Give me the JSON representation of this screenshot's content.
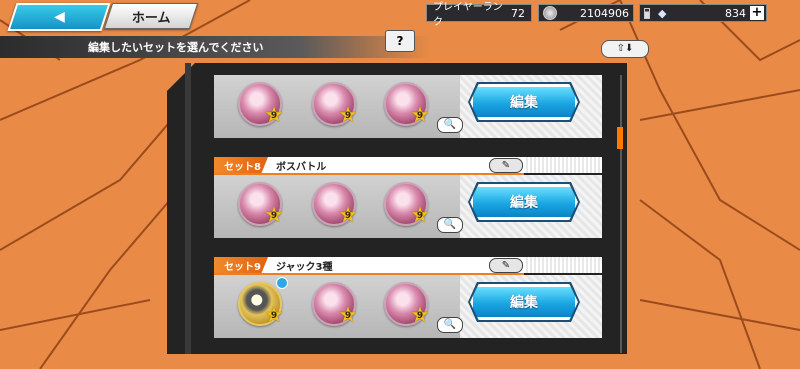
{
  "header": {
    "back_arrow": "◀",
    "home_label": "ホーム",
    "rank_label": "プレイヤーランク",
    "rank_value": "72",
    "coins": "2104906",
    "gems": "834",
    "plus": "+"
  },
  "instruction": "編集したいセットを選んでください",
  "help_label": "?",
  "sort_label": "⇧⬇",
  "sets": [
    {
      "tag": "",
      "name": "",
      "edit_label": "編集",
      "star_levels": [
        "9",
        "9",
        "9"
      ],
      "zoom_icon": "🔍"
    },
    {
      "tag": "セット8",
      "name": "ボスバトル",
      "edit_label": "編集",
      "pencil": "✎",
      "star_levels": [
        "9",
        "9",
        "9"
      ],
      "zoom_icon": "🔍"
    },
    {
      "tag": "セット9",
      "name": "ジャック3種",
      "edit_label": "編集",
      "pencil": "✎",
      "star_levels": [
        "9",
        "9",
        "9"
      ],
      "zoom_icon": "🔍"
    }
  ],
  "colors": {
    "accent_orange": "#f07d1e",
    "edit_blue": "#1aa6e2",
    "background": "#e98a46"
  }
}
